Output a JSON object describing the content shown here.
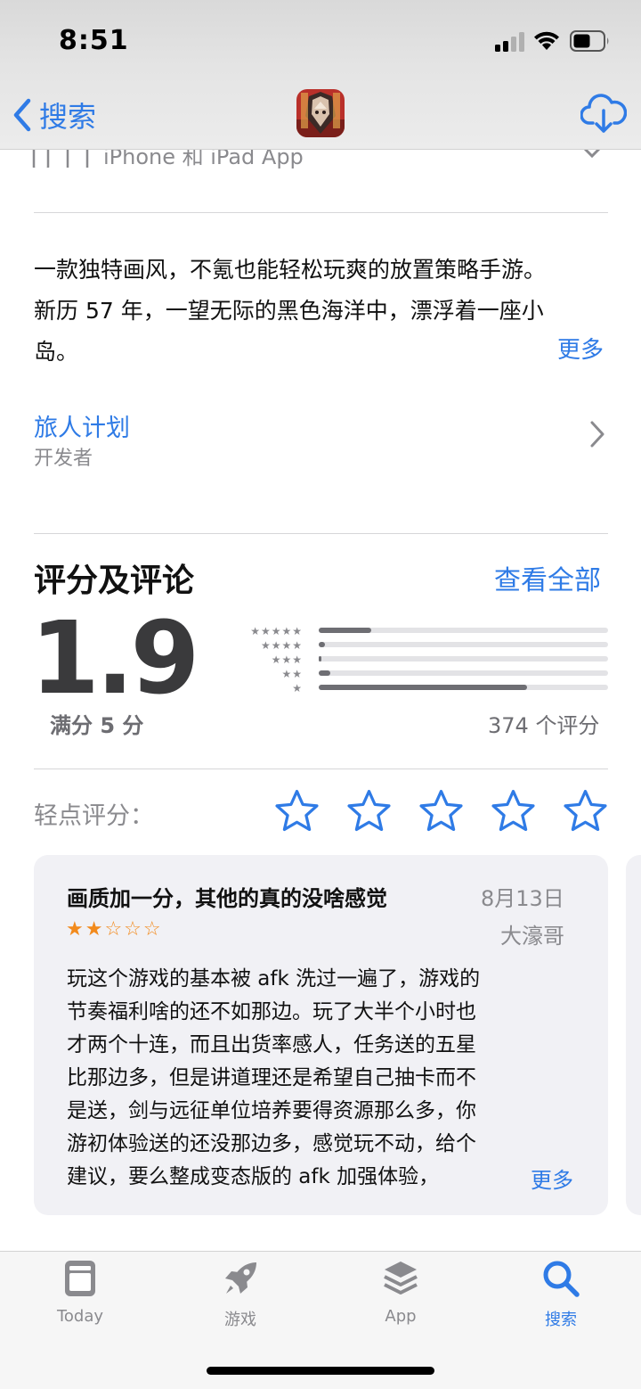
{
  "status_bar": {
    "time": "8:51"
  },
  "nav": {
    "back_label": "搜索"
  },
  "clipped_row": {
    "text": "iPhone 和 iPad App"
  },
  "description": {
    "lines": [
      "一款独特画风，不氪也能轻松玩爽的放置策略手游。",
      "新历 57 年，一望无际的黑色海洋中，漂浮着一座小",
      "岛。"
    ],
    "more_label": "更多"
  },
  "developer": {
    "name": "旅人计划",
    "label": "开发者"
  },
  "ratings": {
    "title": "评分及评论",
    "see_all": "查看全部",
    "score": "1.9",
    "out_of": "满分 5 分",
    "count": "374 个评分",
    "histogram": [
      {
        "stars": "★★★★★",
        "fraction": 0.18
      },
      {
        "stars": "★★★★",
        "fraction": 0.02
      },
      {
        "stars": "★★★",
        "fraction": 0.01
      },
      {
        "stars": "★★",
        "fraction": 0.04
      },
      {
        "stars": "★",
        "fraction": 0.72
      }
    ]
  },
  "tap_to_rate": {
    "label": "轻点评分："
  },
  "review": {
    "title": "画质加一分，其他的真的没啥感觉",
    "date": "8月13日",
    "stars": "★★☆☆☆",
    "rating": 2,
    "author": "大濠哥",
    "body_lines": [
      "玩这个游戏的基本被 afk 洗过一遍了，游戏的",
      "节奏福利啥的还不如那边。玩了大半个小时也",
      "才两个十连，而且出货率感人，任务送的五星",
      "比那边多，但是讲道理还是希望自己抽卡而不",
      "是送，剑与远征单位培养要得资源那么多，你",
      "游初体验送的还没那边多，感觉玩不动，给个",
      "建议，要么整成变态版的 afk 加强体验，"
    ],
    "more_label": "更多"
  },
  "tabbar": {
    "today": "Today",
    "games": "游戏",
    "apps": "App",
    "search": "搜索"
  },
  "colors": {
    "accent": "#2f7be6",
    "review_star": "#f28a1c"
  }
}
